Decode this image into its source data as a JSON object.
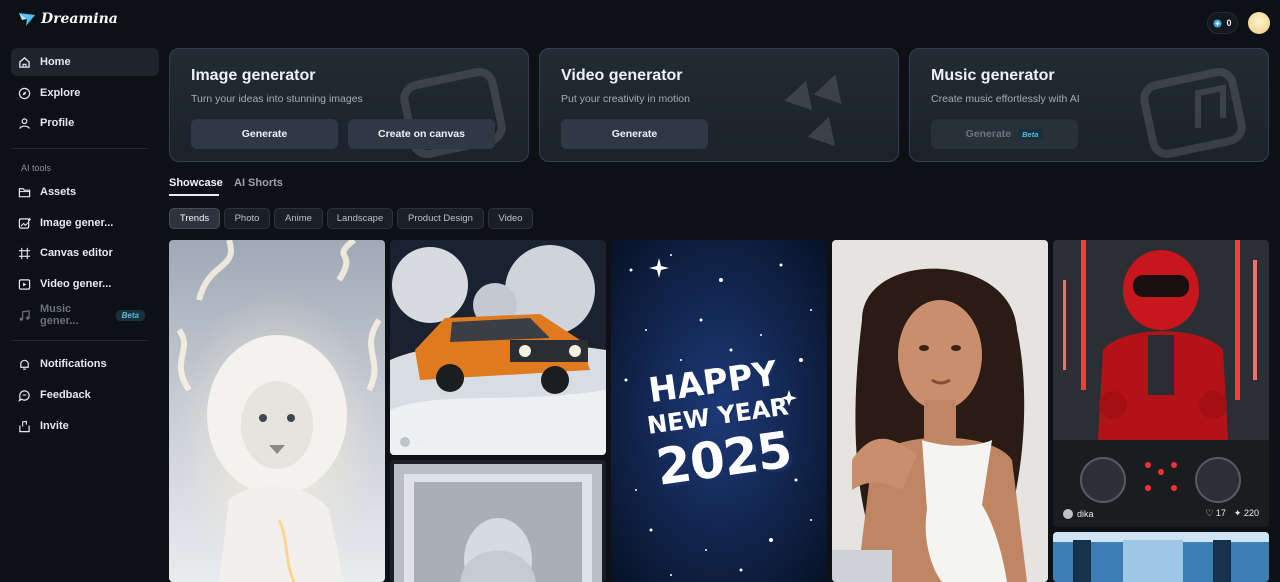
{
  "app": {
    "name": "Dreamina"
  },
  "sidebar": {
    "nav": [
      {
        "label": "Home",
        "icon": "home-icon",
        "active": true
      },
      {
        "label": "Explore",
        "icon": "compass-icon"
      },
      {
        "label": "Profile",
        "icon": "user-icon"
      }
    ],
    "ai_tools_label": "AI tools",
    "tools": [
      {
        "label": "Assets",
        "icon": "folder-icon"
      },
      {
        "label": "Image gener...",
        "icon": "image-icon"
      },
      {
        "label": "Canvas editor",
        "icon": "canvas-icon"
      },
      {
        "label": "Video gener...",
        "icon": "video-icon"
      },
      {
        "label": "Music gener...",
        "icon": "music-icon",
        "disabled": true,
        "badge": "Beta"
      }
    ],
    "bottom": [
      {
        "label": "Notifications",
        "icon": "bell-icon"
      },
      {
        "label": "Feedback",
        "icon": "chat-icon"
      },
      {
        "label": "Invite",
        "icon": "invite-icon"
      }
    ]
  },
  "topbar": {
    "credits": "0"
  },
  "generators": [
    {
      "title": "Image generator",
      "subtitle": "Turn your ideas into stunning images",
      "buttons": [
        "Generate",
        "Create on canvas"
      ]
    },
    {
      "title": "Video generator",
      "subtitle": "Put your creativity in motion",
      "buttons": [
        "Generate"
      ]
    },
    {
      "title": "Music generator",
      "subtitle": "Create music effortlessly with AI",
      "buttons": [
        "Generate"
      ],
      "badge": "Beta",
      "disabled": true
    }
  ],
  "tabs": [
    "Showcase",
    "AI Shorts"
  ],
  "filters": [
    "Trends",
    "Photo",
    "Anime",
    "Landscape",
    "Product Design",
    "Video"
  ],
  "gallery": [
    {
      "subject": "white lion"
    },
    {
      "subject": "orange car on moon",
      "author": "Wiz.X",
      "likes": "12",
      "uses": "111"
    },
    {
      "subject": "silver frame portrait"
    },
    {
      "subject": "new year poster",
      "lines": [
        "HAPPY",
        "NEW YEAR",
        "2025"
      ]
    },
    {
      "subject": "woman portrait"
    },
    {
      "subject": "red robot DJ",
      "author": "dika",
      "likes": "17",
      "uses": "220"
    },
    {
      "subject": "blue corridor"
    }
  ],
  "colors": {
    "background": "#0d1014",
    "card": "#1e252e",
    "accent_beta": "#5fb6d8"
  }
}
